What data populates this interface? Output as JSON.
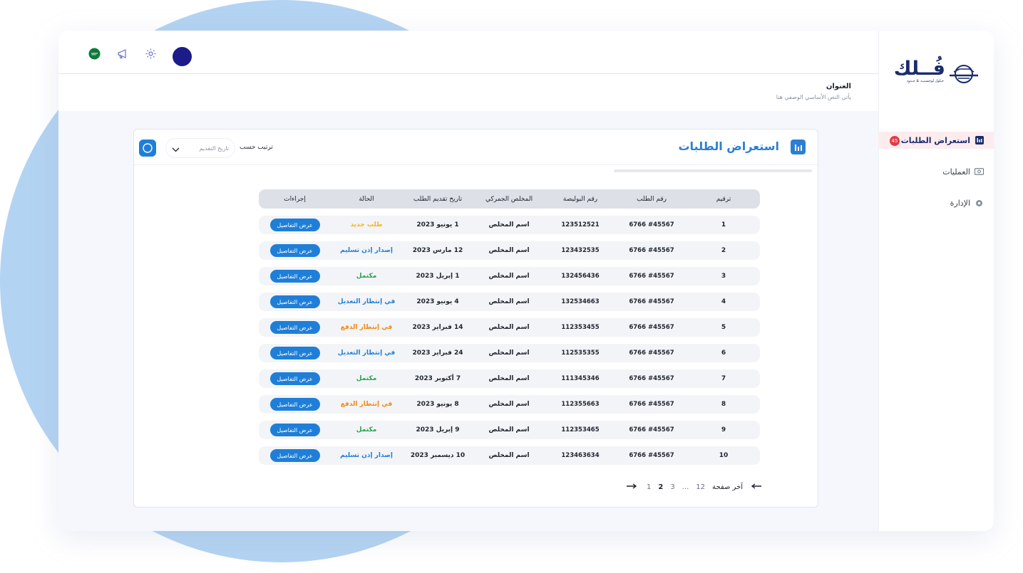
{
  "app": {
    "logo_title": "فُــلك",
    "logo_subtitle": "حـلول لوجستيـة بلا حـدود"
  },
  "header": {
    "title": "العنوان",
    "subtitle": "يأتي النص الأساسي الوصفي هنا"
  },
  "sidebar": {
    "items": [
      {
        "label": "استعراض الطلبات",
        "icon": "bar-chart-icon",
        "badge": "45",
        "active": true
      },
      {
        "label": "العمليات",
        "icon": "money-icon"
      },
      {
        "label": "الإدارة",
        "icon": "gear-icon"
      }
    ]
  },
  "topbar": {
    "icons": [
      "saudi-flag-icon",
      "megaphone-icon",
      "gear-icon",
      "avatar"
    ]
  },
  "card": {
    "title": "استعراض الطلبات",
    "sort_label": "ترتيب حسب",
    "sort_value": "تاريخ التقديم"
  },
  "table": {
    "headers": [
      "ترقيم",
      "رقم الطلب",
      "رقم البوليصة",
      "المخلص الجمركي",
      "تاريخ تقديم الطلب",
      "الحالة",
      "إجراءات"
    ],
    "rows": [
      {
        "num": "1",
        "order": "#45567 6766",
        "policy": "123512521",
        "broker": "اسم المخلص",
        "date": "1 يونيو 2023",
        "status": "طلب جديد",
        "status_color": "#f2b81f",
        "action": "عرض التفاصيل"
      },
      {
        "num": "2",
        "order": "#45567 6766",
        "policy": "123432535",
        "broker": "اسم المخلص",
        "date": "12 مارس 2023",
        "status": "إصدار إذن تسليم",
        "status_color": "#1f7fd8",
        "action": "عرض التفاصيل"
      },
      {
        "num": "3",
        "order": "#45567 6766",
        "policy": "132456436",
        "broker": "اسم المخلص",
        "date": "1 إبريل 2023",
        "status": "مكتمل",
        "status_color": "#22a447",
        "action": "عرض التفاصيل"
      },
      {
        "num": "4",
        "order": "#45567 6766",
        "policy": "132534663",
        "broker": "اسم المخلص",
        "date": "4 يونيو 2023",
        "status": "في إنتظار التعديل",
        "status_color": "#1f7fd8",
        "action": "عرض التفاصيل"
      },
      {
        "num": "5",
        "order": "#45567 6766",
        "policy": "112353455",
        "broker": "اسم المخلص",
        "date": "14 فبراير 2023",
        "status": "في إنتظار الدفع",
        "status_color": "#f08a12",
        "action": "عرض التفاصيل"
      },
      {
        "num": "6",
        "order": "#45567 6766",
        "policy": "112535355",
        "broker": "اسم المخلص",
        "date": "24 فبراير 2023",
        "status": "في إنتظار التعديل",
        "status_color": "#1f7fd8",
        "action": "عرض التفاصيل"
      },
      {
        "num": "7",
        "order": "#45567 6766",
        "policy": "111345346",
        "broker": "اسم المخلص",
        "date": "7 أكتوبر 2023",
        "status": "مكتمل",
        "status_color": "#22a447",
        "action": "عرض التفاصيل"
      },
      {
        "num": "8",
        "order": "#45567 6766",
        "policy": "112355663",
        "broker": "اسم المخلص",
        "date": "8 يونيو 2023",
        "status": "في إنتظار الدفع",
        "status_color": "#f08a12",
        "action": "عرض التفاصيل"
      },
      {
        "num": "9",
        "order": "#45567 6766",
        "policy": "112353465",
        "broker": "اسم المخلص",
        "date": "9 إبريل 2023",
        "status": "مكتمل",
        "status_color": "#22a447",
        "action": "عرض التفاصيل"
      },
      {
        "num": "10",
        "order": "#45567 6766",
        "policy": "123463634",
        "broker": "اسم المخلص",
        "date": "10 ديسمبر 2023",
        "status": "إصدار إذن تسليم",
        "status_color": "#1f7fd8",
        "action": "عرض التفاصيل"
      }
    ]
  },
  "pagination": {
    "pages": [
      "1",
      "2",
      "3",
      "...",
      "12"
    ],
    "current": "2",
    "last_label": "آخر صفحة"
  },
  "colors": {
    "primary": "#1f7fd8",
    "brand": "#1a2c6b",
    "badge": "#e33a45"
  }
}
